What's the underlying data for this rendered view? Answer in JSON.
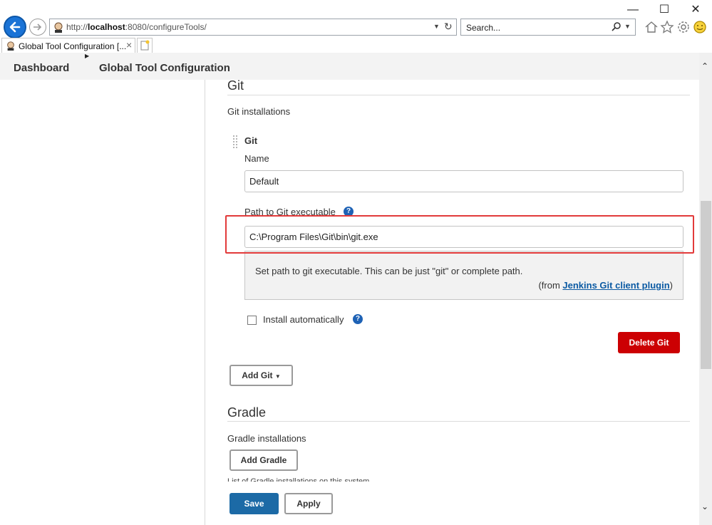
{
  "browser": {
    "address": {
      "prefix": "http://",
      "host": "localhost",
      "rest": ":8080/configureTools/"
    },
    "search_placeholder": "Search...",
    "tab_title": "Global Tool Configuration [...",
    "tab_close": "×",
    "window_minimize": "—",
    "window_maximize": "☐",
    "window_close": "✕"
  },
  "breadcrumb": {
    "dashboard": "Dashboard",
    "current": "Global Tool Configuration"
  },
  "git": {
    "section_title": "Git",
    "installations_label": "Git installations",
    "entry_title": "Git",
    "name_label": "Name",
    "name_value": "Default",
    "path_label": "Path to Git executable",
    "path_value": "C:\\Program Files\\Git\\bin\\git.exe",
    "help_text": "Set path to git executable. This can be just \"git\" or complete path.",
    "help_from_prefix": "(from ",
    "help_from_link": "Jenkins Git client plugin",
    "help_from_suffix": ")",
    "install_auto_label": "Install automatically",
    "delete_button": "Delete Git",
    "add_button": "Add Git"
  },
  "gradle": {
    "section_title": "Gradle",
    "installations_label": "Gradle installations",
    "add_button": "Add Gradle",
    "list_note": "List of Gradle installations on this system"
  },
  "footer": {
    "save": "Save",
    "apply": "Apply"
  },
  "help_icon_glyph": "?",
  "colors": {
    "delete_red": "#cc0003",
    "save_blue": "#1c6aa6",
    "highlight_red": "#e23a3a",
    "link_blue": "#0b5aa3"
  }
}
